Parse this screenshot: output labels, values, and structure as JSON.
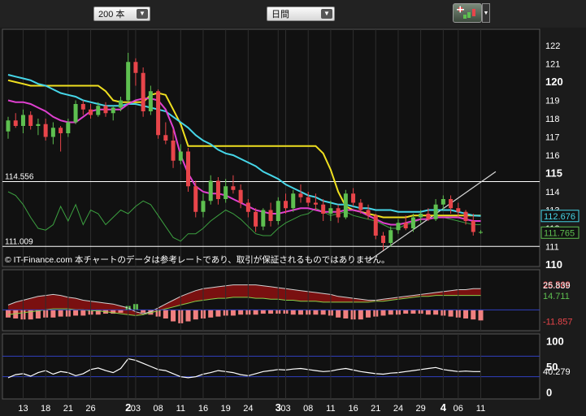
{
  "toolbar": {
    "period_value": "200 本",
    "interval_value": "日間",
    "dropdown_glyph": "▼",
    "tools_icon": "chart-tools-icon"
  },
  "copyright": "© IT-Finance.com  本チャートのデータは参考レートであり、取引が保証されるものではありません。",
  "colors": {
    "bull": "#5ec050",
    "bear": "#e8454a",
    "ma_short": "#46d6e8",
    "ma_mid": "#e040d0",
    "ma_long": "#f0e020",
    "line_green": "#3ca040",
    "rsi": "#ffffff"
  },
  "chart_data": [
    {
      "type": "candlestick",
      "name": "price",
      "y_ticks": [
        "122",
        "121",
        "120",
        "119",
        "118",
        "117",
        "116",
        "115",
        "114",
        "113",
        "112",
        "111",
        "110"
      ],
      "major_ticks": [
        "120",
        "115",
        "110"
      ],
      "ylim": [
        110,
        122.8
      ],
      "h_lines": [
        {
          "value": 114.556,
          "label": "114.556"
        },
        {
          "value": 111.009,
          "label": "111.009"
        }
      ],
      "last_value_labels": [
        {
          "value": 112.676,
          "label": "112.676",
          "color": "#46d6e8"
        },
        {
          "value": 111.765,
          "label": "111.765",
          "color": "#5ec050"
        }
      ],
      "x_ticks": [
        {
          "label": "13",
          "i": 2
        },
        {
          "label": "18",
          "i": 5
        },
        {
          "label": "21",
          "i": 8
        },
        {
          "label": "26",
          "i": 11
        },
        {
          "label": "2",
          "i": 16,
          "major": true
        },
        {
          "label": "03",
          "i": 17
        },
        {
          "label": "08",
          "i": 20
        },
        {
          "label": "11",
          "i": 23
        },
        {
          "label": "16",
          "i": 26
        },
        {
          "label": "19",
          "i": 29
        },
        {
          "label": "24",
          "i": 32
        },
        {
          "label": "3",
          "i": 36,
          "major": true
        },
        {
          "label": "03",
          "i": 37
        },
        {
          "label": "08",
          "i": 40
        },
        {
          "label": "11",
          "i": 43
        },
        {
          "label": "16",
          "i": 46
        },
        {
          "label": "21",
          "i": 49
        },
        {
          "label": "24",
          "i": 52
        },
        {
          "label": "29",
          "i": 55
        },
        {
          "label": "4",
          "i": 58,
          "major": true
        },
        {
          "label": "06",
          "i": 60
        },
        {
          "label": "11",
          "i": 63
        }
      ],
      "candles": [
        [
          117.3,
          118.1,
          116.9,
          117.9
        ],
        [
          117.9,
          118.3,
          117.5,
          117.6
        ],
        [
          117.6,
          118.5,
          117.2,
          118.2
        ],
        [
          118.2,
          118.4,
          117.4,
          117.6
        ],
        [
          117.6,
          118.0,
          117.1,
          117.7
        ],
        [
          117.7,
          118.0,
          116.8,
          117.0
        ],
        [
          117.0,
          117.8,
          116.6,
          117.5
        ],
        [
          117.5,
          117.6,
          116.2,
          117.2
        ],
        [
          117.2,
          118.0,
          117.0,
          117.8
        ],
        [
          117.8,
          119.0,
          117.7,
          118.8
        ],
        [
          118.8,
          119.0,
          118.2,
          118.5
        ],
        [
          118.5,
          118.8,
          118.0,
          118.2
        ],
        [
          118.2,
          118.9,
          118.1,
          118.7
        ],
        [
          118.7,
          118.9,
          118.1,
          118.3
        ],
        [
          118.3,
          118.7,
          117.9,
          118.6
        ],
        [
          118.6,
          119.2,
          118.4,
          119.0
        ],
        [
          119.0,
          121.6,
          118.9,
          121.1
        ],
        [
          121.1,
          121.3,
          119.8,
          120.5
        ],
        [
          120.5,
          120.8,
          118.1,
          118.4
        ],
        [
          118.4,
          119.8,
          118.2,
          119.5
        ],
        [
          119.5,
          119.6,
          116.9,
          117.1
        ],
        [
          117.1,
          117.8,
          116.6,
          116.8
        ],
        [
          116.8,
          117.4,
          115.3,
          115.7
        ],
        [
          115.7,
          116.6,
          115.5,
          116.2
        ],
        [
          116.2,
          116.4,
          114.0,
          114.3
        ],
        [
          114.3,
          114.6,
          112.6,
          112.9
        ],
        [
          112.9,
          113.9,
          112.6,
          113.5
        ],
        [
          113.5,
          114.9,
          113.3,
          114.6
        ],
        [
          114.6,
          114.8,
          113.3,
          113.6
        ],
        [
          113.6,
          114.7,
          113.4,
          114.3
        ],
        [
          114.3,
          114.9,
          113.9,
          114.1
        ],
        [
          114.1,
          114.4,
          113.1,
          113.4
        ],
        [
          113.4,
          113.6,
          112.6,
          112.9
        ],
        [
          112.9,
          113.1,
          111.8,
          112.1
        ],
        [
          112.1,
          113.1,
          111.9,
          113.0
        ],
        [
          113.0,
          113.4,
          112.1,
          112.4
        ],
        [
          112.4,
          113.7,
          112.2,
          113.5
        ],
        [
          113.5,
          113.9,
          112.8,
          113.1
        ],
        [
          113.1,
          114.1,
          112.9,
          113.9
        ],
        [
          113.9,
          114.4,
          113.4,
          113.7
        ],
        [
          113.7,
          114.0,
          113.2,
          113.4
        ],
        [
          113.4,
          113.9,
          113.0,
          113.3
        ],
        [
          113.3,
          113.6,
          112.4,
          112.8
        ],
        [
          112.8,
          113.5,
          112.4,
          113.1
        ],
        [
          113.1,
          113.3,
          112.3,
          112.6
        ],
        [
          112.6,
          114.1,
          112.5,
          113.9
        ],
        [
          113.9,
          114.2,
          113.2,
          113.4
        ],
        [
          113.4,
          113.6,
          112.8,
          113.0
        ],
        [
          113.0,
          113.3,
          112.5,
          112.7
        ],
        [
          112.7,
          112.8,
          111.4,
          111.6
        ],
        [
          111.6,
          111.8,
          110.8,
          111.2
        ],
        [
          111.2,
          112.1,
          111.0,
          111.9
        ],
        [
          111.9,
          112.5,
          111.7,
          112.3
        ],
        [
          112.3,
          112.7,
          111.9,
          112.0
        ],
        [
          112.0,
          112.8,
          111.8,
          112.6
        ],
        [
          112.6,
          113.0,
          112.3,
          112.8
        ],
        [
          112.8,
          113.1,
          112.4,
          112.5
        ],
        [
          112.5,
          113.6,
          112.4,
          113.3
        ],
        [
          113.3,
          113.8,
          113.0,
          113.6
        ],
        [
          113.6,
          113.8,
          112.8,
          113.1
        ],
        [
          113.1,
          113.4,
          112.6,
          112.9
        ],
        [
          112.9,
          113.0,
          112.2,
          112.4
        ],
        [
          112.4,
          112.8,
          111.6,
          111.8
        ],
        [
          111.8,
          111.9,
          111.7,
          111.8
        ]
      ],
      "ma_short": [
        120.4,
        120.3,
        120.2,
        120.1,
        119.9,
        119.8,
        119.6,
        119.4,
        119.3,
        119.2,
        119.0,
        118.9,
        118.8,
        118.7,
        118.7,
        118.7,
        118.8,
        118.8,
        118.7,
        118.6,
        118.5,
        118.4,
        118.1,
        117.8,
        117.5,
        117.1,
        116.8,
        116.6,
        116.3,
        116.1,
        116.0,
        115.8,
        115.6,
        115.4,
        115.1,
        114.9,
        114.7,
        114.4,
        114.2,
        114.0,
        113.8,
        113.7,
        113.5,
        113.4,
        113.3,
        113.3,
        113.2,
        113.1,
        113.1,
        113.0,
        113.0,
        113.0,
        112.9,
        112.9,
        112.9,
        112.9,
        113.0,
        113.0,
        113.0,
        113.0,
        112.9,
        112.8,
        112.7,
        112.68
      ],
      "ma_mid": [
        119.0,
        118.9,
        118.9,
        118.8,
        118.6,
        118.4,
        118.1,
        117.9,
        117.8,
        117.8,
        118.1,
        118.4,
        118.5,
        118.5,
        118.5,
        118.5,
        118.8,
        119.0,
        119.1,
        119.1,
        119.0,
        118.5,
        117.5,
        116.0,
        115.0,
        114.3,
        114.0,
        113.9,
        113.9,
        113.8,
        113.6,
        113.4,
        113.2,
        113.0,
        112.9,
        112.8,
        112.8,
        112.9,
        113.0,
        113.1,
        113.1,
        113.0,
        112.9,
        112.9,
        112.9,
        113.0,
        113.0,
        112.9,
        112.7,
        112.5,
        112.3,
        112.2,
        112.2,
        112.3,
        112.4,
        112.5,
        112.5,
        112.6,
        112.6,
        112.6,
        112.6,
        112.5,
        112.4,
        112.4
      ],
      "ma_long": [
        120.1,
        120.0,
        119.9,
        119.8,
        119.8,
        119.8,
        119.8,
        119.8,
        119.8,
        119.8,
        119.8,
        119.8,
        119.8,
        119.5,
        119.0,
        118.9,
        118.9,
        118.9,
        118.9,
        119.3,
        119.4,
        119.3,
        118.5,
        117.7,
        116.5,
        116.5,
        116.5,
        116.5,
        116.5,
        116.5,
        116.5,
        116.5,
        116.5,
        116.5,
        116.5,
        116.5,
        116.5,
        116.5,
        116.5,
        116.5,
        116.5,
        116.5,
        116.1,
        115.2,
        114.0,
        113.2,
        113.0,
        112.9,
        112.8,
        112.7,
        112.6,
        112.6,
        112.6,
        112.6,
        112.7,
        112.7,
        112.7,
        112.7,
        112.7,
        112.7,
        112.7,
        112.7,
        112.7,
        112.7
      ],
      "green_line": [
        114.0,
        113.8,
        113.3,
        112.6,
        112.0,
        111.9,
        112.2,
        113.2,
        112.4,
        113.3,
        112.2,
        113.0,
        112.8,
        112.2,
        112.6,
        113.0,
        112.8,
        113.2,
        113.5,
        113.3,
        112.7,
        112.1,
        111.5,
        111.3,
        111.7,
        111.7,
        112.0,
        112.4,
        112.7,
        113.0,
        112.8,
        112.5,
        112.1,
        111.7,
        111.6,
        111.6,
        112.0,
        112.3,
        112.5,
        112.7,
        112.8,
        113.1,
        112.9,
        112.7,
        112.8,
        112.9,
        112.7,
        112.6,
        112.5,
        112.4,
        112.2,
        112.0,
        112.0,
        112.2,
        112.3,
        112.5,
        112.5,
        112.6,
        112.6,
        112.5,
        112.4,
        112.3,
        112.2,
        112.2
      ],
      "trendline": {
        "from": [
          48,
          110.2
        ],
        "to": [
          65,
          115.1
        ]
      }
    },
    {
      "type": "area",
      "name": "oscillator",
      "value_labels": [
        "26.568",
        "25.839",
        "14.711",
        "-11.857"
      ],
      "upper": [
        5,
        8,
        10,
        12,
        14,
        15,
        16,
        15,
        13,
        12,
        10,
        9,
        8,
        7,
        6,
        4,
        2,
        -2,
        -4,
        -2,
        2,
        6,
        10,
        14,
        17,
        20,
        22,
        23,
        24,
        25,
        26,
        26,
        26,
        26,
        25,
        24,
        23,
        22,
        21,
        20,
        19,
        18,
        17,
        16,
        14,
        13,
        12,
        11,
        10,
        10,
        11,
        12,
        13,
        14,
        15,
        16,
        17,
        18,
        19,
        20,
        21,
        21,
        22,
        22
      ],
      "lower": [
        -5,
        -4,
        -3,
        -2,
        -1,
        0,
        1,
        1,
        1,
        0,
        0,
        -1,
        -1,
        -2,
        -3,
        -4,
        -5,
        -6,
        -5,
        -3,
        -1,
        1,
        3,
        5,
        7,
        9,
        10,
        11,
        12,
        12,
        13,
        13,
        13,
        12,
        12,
        11,
        11,
        10,
        10,
        9,
        9,
        9,
        8,
        8,
        8,
        8,
        8,
        8,
        8,
        9,
        9,
        10,
        11,
        12,
        13,
        14,
        14,
        15,
        15,
        15,
        15,
        15,
        15,
        15
      ],
      "histogram": [
        -8,
        -9,
        -10,
        -10,
        -9,
        -8,
        -8,
        -7,
        -7,
        -6,
        -6,
        -5,
        -5,
        -4,
        -4,
        -3,
        4,
        6,
        -3,
        -5,
        -7,
        -9,
        -12,
        -14,
        -12,
        -10,
        -9,
        -8,
        -7,
        -6,
        -6,
        -5,
        -5,
        -5,
        -4,
        -4,
        -4,
        -4,
        -5,
        -5,
        -5,
        -5,
        -5,
        -6,
        -8,
        -9,
        -10,
        -10,
        -8,
        -7,
        -6,
        -5,
        -5,
        -4,
        -4,
        -4,
        -5,
        -5,
        -6,
        -7,
        -8,
        -9,
        -10,
        -11
      ],
      "ylim": [
        -20,
        40
      ]
    },
    {
      "type": "line",
      "name": "rsi",
      "y_ticks": [
        "100",
        "50",
        "0"
      ],
      "last_value_label": "40.279",
      "guide_levels": [
        70,
        30
      ],
      "values": [
        28,
        34,
        36,
        31,
        38,
        42,
        35,
        40,
        38,
        32,
        36,
        44,
        47,
        42,
        38,
        46,
        65,
        62,
        56,
        50,
        44,
        42,
        36,
        30,
        28,
        30,
        35,
        38,
        42,
        40,
        38,
        34,
        32,
        36,
        40,
        42,
        44,
        43,
        45,
        46,
        44,
        42,
        40,
        41,
        44,
        46,
        43,
        40,
        38,
        36,
        35,
        37,
        38,
        40,
        42,
        44,
        46,
        48,
        44,
        42,
        40,
        41,
        40,
        40
      ],
      "ylim": [
        -10,
        110
      ]
    }
  ]
}
